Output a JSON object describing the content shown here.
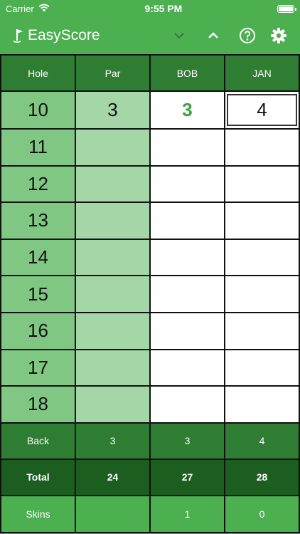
{
  "status": {
    "carrier": "Carrier",
    "time": "9:55 PM"
  },
  "nav": {
    "brand": "EasyScore"
  },
  "table": {
    "headers": [
      "Hole",
      "Par",
      "BOB",
      "JAN"
    ],
    "rows": [
      {
        "hole": "10",
        "par": "3",
        "bob": "3",
        "jan": "4"
      },
      {
        "hole": "11",
        "par": "",
        "bob": "",
        "jan": ""
      },
      {
        "hole": "12",
        "par": "",
        "bob": "",
        "jan": ""
      },
      {
        "hole": "13",
        "par": "",
        "bob": "",
        "jan": ""
      },
      {
        "hole": "14",
        "par": "",
        "bob": "",
        "jan": ""
      },
      {
        "hole": "15",
        "par": "",
        "bob": "",
        "jan": ""
      },
      {
        "hole": "16",
        "par": "",
        "bob": "",
        "jan": ""
      },
      {
        "hole": "17",
        "par": "",
        "bob": "",
        "jan": ""
      },
      {
        "hole": "18",
        "par": "",
        "bob": "",
        "jan": ""
      }
    ],
    "back": {
      "label": "Back",
      "par": "3",
      "bob": "3",
      "jan": "4"
    },
    "total": {
      "label": "Total",
      "par": "24",
      "bob": "27",
      "jan": "28"
    },
    "skins": {
      "label": "Skins",
      "par": "",
      "bob": "1",
      "jan": "0"
    }
  },
  "colors": {
    "brand_green": "#4caf50",
    "header_green": "#2e7d32",
    "total_green": "#1b5e20",
    "hole_green": "#81c784",
    "par_green": "#a5d6a7",
    "highlight_score": "#43a047"
  },
  "icons": [
    "wifi-icon",
    "battery-icon",
    "golf-flag-icon",
    "chevron-down-icon",
    "chevron-up-icon",
    "help-icon",
    "gear-icon"
  ]
}
